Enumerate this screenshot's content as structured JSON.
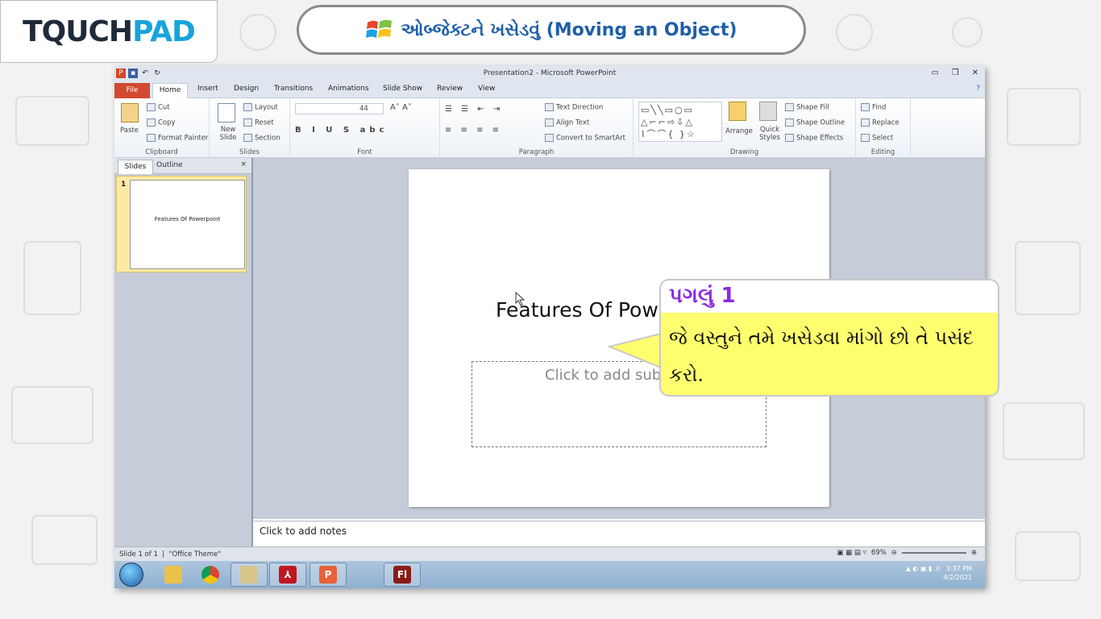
{
  "brand": {
    "logo_a": "T",
    "logo_mid": "Q",
    "logo_b": "UCH",
    "logo_c": "PAD"
  },
  "header": {
    "title": "ઓબ્જેક્ટને ખસેડવું (Moving an Object)"
  },
  "window": {
    "title": "Presentation2 - Microsoft PowerPoint"
  },
  "tabs": [
    "File",
    "Home",
    "Insert",
    "Design",
    "Transitions",
    "Animations",
    "Slide Show",
    "Review",
    "View"
  ],
  "ribbon": {
    "clipboard": {
      "paste": "Paste",
      "cut": "Cut",
      "copy": "Copy",
      "format_painter": "Format Painter",
      "label": "Clipboard"
    },
    "slides": {
      "new_slide": "New Slide",
      "layout": "Layout",
      "reset": "Reset",
      "section": "Section",
      "label": "Slides"
    },
    "font": {
      "size": "44",
      "label": "Font"
    },
    "paragraph": {
      "text_direction": "Text Direction",
      "align_text": "Align Text",
      "convert": "Convert to SmartArt",
      "label": "Paragraph"
    },
    "drawing": {
      "arrange": "Arrange",
      "quick_styles": "Quick Styles",
      "shape_fill": "Shape Fill",
      "shape_outline": "Shape Outline",
      "shape_effects": "Shape Effects",
      "label": "Drawing"
    },
    "editing": {
      "find": "Find",
      "replace": "Replace",
      "select": "Select",
      "label": "Editing"
    }
  },
  "panel": {
    "tab_slides": "Slides",
    "tab_outline": "Outline",
    "close": "×",
    "slide_number": "1",
    "thumb_title": "Features Of Powerpoint"
  },
  "slide": {
    "title": "Features Of Pow",
    "subtitle": "Click to add sub"
  },
  "notes": {
    "placeholder": "Click to add notes"
  },
  "status": {
    "slide": "Slide 1 of 1",
    "theme": "\"Office Theme\"",
    "zoom": "69%"
  },
  "clock": {
    "time": "3:37 PM",
    "date": "4/2/2021"
  },
  "callout": {
    "step": "પગલું 1",
    "text": "જે વસ્તુને તમે ખસેડવા માંગો છો તે પસંદ કરો."
  }
}
